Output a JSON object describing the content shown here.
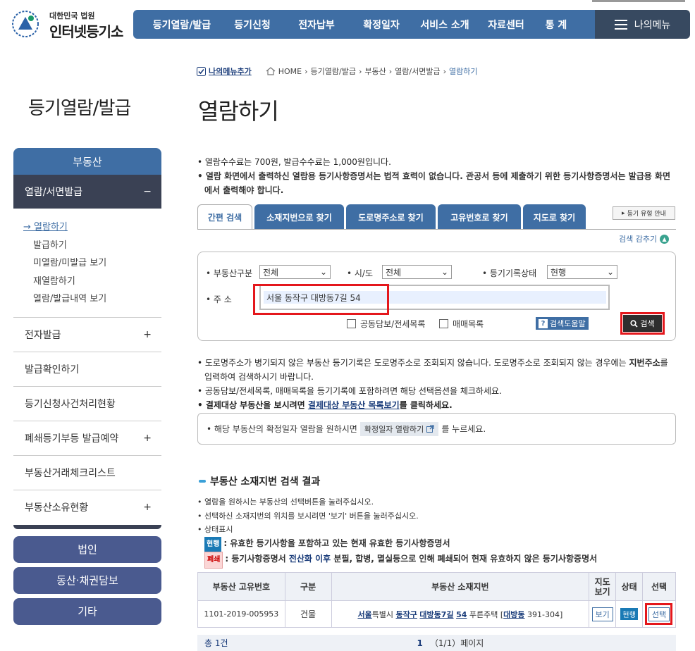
{
  "header": {
    "logo_small": "대한민국 법원",
    "logo_big": "인터넷등기소",
    "menu": [
      "등기열람/발급",
      "등기신청",
      "전자납부",
      "확정일자",
      "서비스 소개",
      "자료센터",
      "통 계"
    ],
    "my_menu": "나의메뉴"
  },
  "lnb": {
    "title": "등기열람/발급",
    "category": "부동산",
    "active_sub": "열람/서면발급",
    "active_sub_sign": "−",
    "subitems": [
      "→ 열람하기",
      "발급하기",
      "미열람/미발급 보기",
      "재열람하기",
      "열람/발급내역 보기"
    ],
    "items": [
      {
        "label": "전자발급",
        "sign": "+"
      },
      {
        "label": "발급확인하기",
        "sign": ""
      },
      {
        "label": "등기신청사건처리현황",
        "sign": ""
      },
      {
        "label": "폐쇄등기부등 발급예약",
        "sign": "+"
      },
      {
        "label": "부동산거래체크리스트",
        "sign": ""
      },
      {
        "label": "부동산소유현황",
        "sign": "+"
      }
    ],
    "big_buttons": [
      "법인",
      "동산·채권담보",
      "기타"
    ]
  },
  "breadcrumb": {
    "my_add": "나의메뉴추가",
    "path": [
      "HOME",
      "등기열람/발급",
      "부동산",
      "열람/서면발급"
    ],
    "current": "열람하기"
  },
  "page_title": "열람하기",
  "notes": [
    "• 열람수수료는 700원, 발급수수료는 1,000원입니다.",
    "• 열람 화면에서 출력하신 열람용 등기사항증명서는 법적 효력이 없습니다. 관공서 등에 제출하기 위한 등기사항증명서는 발급용 화면에서 출력해야 합니다."
  ],
  "tabs": [
    "간편 검색",
    "소재지번으로 찾기",
    "도로명주소로 찾기",
    "고유번호로 찾기",
    "지도로 찾기"
  ],
  "guide_button": "등기 유형 안내",
  "collapse_label": "검색 감추기",
  "search": {
    "type_label": "• 부동산구분",
    "type_value": "전체",
    "sido_label": "• 시/도",
    "sido_value": "전체",
    "status_label": "• 등기기록상태",
    "status_value": "현행",
    "addr_label": "• 주 소",
    "addr_value": "서울 동작구 대방동7길 54",
    "check1": "공동담보/전세목록",
    "check2": "매매목록",
    "help": "검색도움말",
    "search_btn": "검색"
  },
  "notes2": {
    "n1a": "• 도로명주소가 병기되지 않은 부동산 등기기록은 도로명주소로 조회되지 않습니다. 도로명주소로 조회되지 않는 경우에는 ",
    "n1b": "지번주소",
    "n1c": "를 입력하여 검색하시기 바랍니다.",
    "n2": "• 공동담보/전세목록, 매매목록을 등기기록에 포함하려면 해당 선택옵션을 체크하세요.",
    "n3a": "• 결제대상 부동산을 보시려면 ",
    "n3b": "결제대상 부동산 목록보기",
    "n3c": "를 클릭하세요."
  },
  "fixbox": {
    "text1": "• 해당 부동산의 확정일자 열람을 원하시면",
    "btn": "확정일자 열람하기",
    "text2": "를 누르세요."
  },
  "result": {
    "title": "부동산 소재지번 검색 결과",
    "notes": [
      "• 열람을 원하시는 부동산의 선택버튼을 눌러주십시오.",
      "• 선택하신 소재지번의 위치를 보시려면 '보기' 버튼을 눌러주십시오.",
      "• 상태표시"
    ],
    "badge_now": "현행",
    "badge_now_desc": ": 유효한 등기사항을 포함하고 있는 현재 유효한 등기사항증명서",
    "badge_closed": "폐쇄",
    "badge_closed_desc_a": ": 등기사항증명서 ",
    "badge_closed_desc_b": "전산화 이후",
    "badge_closed_desc_c": " 분필, 합병, 멸실등으로 인해 폐쇄되어 현재 유효하지 않은 등기사항증명서",
    "headers": [
      "부동산 고유번호",
      "구분",
      "부동산 소재지번",
      "지도\n보기",
      "상태",
      "선택"
    ],
    "row": {
      "id": "1101-2019-005953",
      "kind": "건물",
      "a1": "서울",
      "a2": "특별시 ",
      "a3": "동작구",
      "a4": " ",
      "a5": "대방동7길",
      "a6": " ",
      "a7": "54",
      "a8": " 푸른주택 [",
      "a9": "대방동",
      "a10": " 391-304]",
      "map": "보기",
      "status": "현행",
      "select": "선택"
    },
    "total": "총 1건",
    "page": "1",
    "page_info": "（1/1）페이지"
  }
}
